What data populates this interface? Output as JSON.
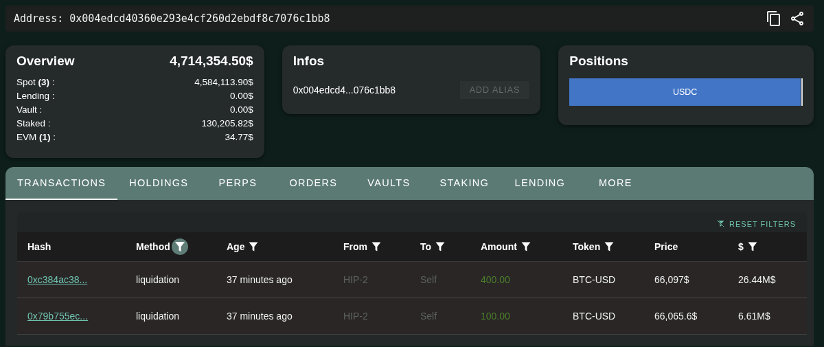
{
  "address": {
    "label": "Address:",
    "value": "0x004edcd40360e293e4cf260d2ebdf8c7076c1bb8"
  },
  "overview": {
    "title": "Overview",
    "total": "4,714,354.50$",
    "rows": [
      {
        "label": "Spot **(3)** :",
        "value": "4,584,113.90$"
      },
      {
        "label": "Lending :",
        "value": "0.00$"
      },
      {
        "label": "Vault :",
        "value": "0.00$"
      },
      {
        "label": "Staked :",
        "value": "130,205.82$"
      },
      {
        "label": "EVM **(1)** :",
        "value": "34.77$"
      }
    ]
  },
  "infos": {
    "title": "Infos",
    "address": "0x004edcd4...076c1bb8",
    "button": "ADD ALIAS",
    "button_disabled": true
  },
  "positions": {
    "title": "Positions",
    "segments": [
      {
        "label": "USDC",
        "level": 0.997,
        "color": "#4275c6"
      }
    ]
  },
  "tabs": [
    {
      "label": "TRANSACTIONS",
      "selected": true
    },
    {
      "label": "HOLDINGS",
      "selected": false
    },
    {
      "label": "PERPS",
      "selected": false
    },
    {
      "label": "ORDERS",
      "selected": false
    },
    {
      "label": "VAULTS",
      "selected": false
    },
    {
      "label": "STAKING",
      "selected": false
    },
    {
      "label": "LENDING",
      "selected": false
    },
    {
      "label": "MORE",
      "selected": false
    }
  ],
  "reset_filters": "RESET FILTERS",
  "table": {
    "columns": [
      {
        "label": "Hash",
        "filterable": false
      },
      {
        "label": "Method",
        "filterable": true,
        "filter_active": true
      },
      {
        "label": "Age",
        "filterable": true,
        "filter_active": false
      },
      {
        "label": "From",
        "filterable": true,
        "filter_active": false
      },
      {
        "label": "To",
        "filterable": true,
        "filter_active": false
      },
      {
        "label": "Amount",
        "filterable": true,
        "filter_active": false
      },
      {
        "label": "Token",
        "filterable": true,
        "filter_active": false
      },
      {
        "label": "Price",
        "filterable": false
      },
      {
        "label": "$",
        "filterable": true,
        "filter_active": false
      }
    ],
    "rows": [
      [
        {
          "text": "0xc384ac38...",
          "kind": "link"
        },
        {
          "text": "liquidation",
          "kind": "text"
        },
        {
          "text": "37 minutes ago",
          "kind": "text"
        },
        {
          "text": "HIP-2",
          "kind": "muted"
        },
        {
          "text": "Self",
          "kind": "muted"
        },
        {
          "text": "400.00",
          "kind": "positive"
        },
        {
          "text": "BTC-USD",
          "kind": "text"
        },
        {
          "text": "66,097$",
          "kind": "text"
        },
        {
          "text": "26.44M$",
          "kind": "text"
        }
      ],
      [
        {
          "text": "0x79b755ec...",
          "kind": "link"
        },
        {
          "text": "liquidation",
          "kind": "text"
        },
        {
          "text": "37 minutes ago",
          "kind": "text"
        },
        {
          "text": "HIP-2",
          "kind": "muted"
        },
        {
          "text": "Self",
          "kind": "muted"
        },
        {
          "text": "100.00",
          "kind": "positive"
        },
        {
          "text": "BTC-USD",
          "kind": "text"
        },
        {
          "text": "66,065.6$",
          "kind": "text"
        },
        {
          "text": "6.61M$",
          "kind": "text"
        }
      ]
    ]
  }
}
